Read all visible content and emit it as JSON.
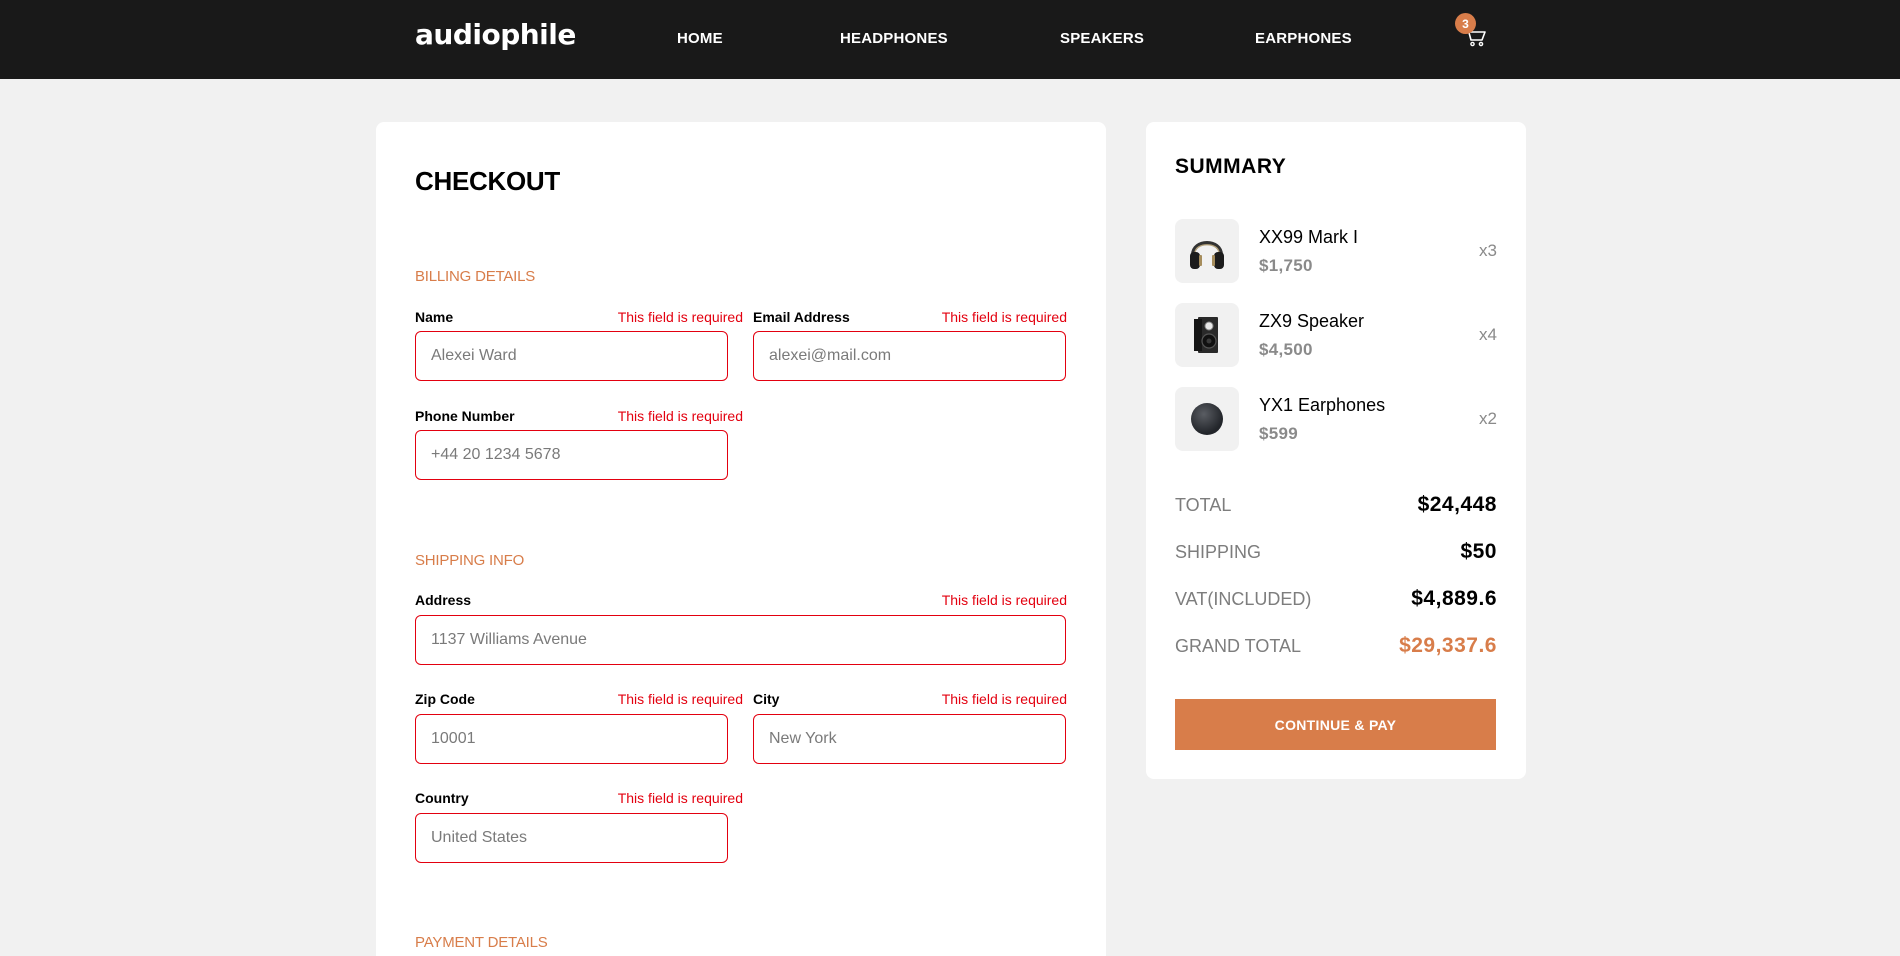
{
  "header": {
    "logo": "audiophile",
    "nav": [
      "HOME",
      "HEADPHONES",
      "SPEAKERS",
      "EARPHONES"
    ],
    "cart_count": "3",
    "cart_icon": "cart-icon"
  },
  "checkout": {
    "title": "CHECKOUT",
    "billing": {
      "title": "BILLING DETAILS",
      "name": {
        "label": "Name",
        "error": "This field is required",
        "placeholder": "Alexei Ward"
      },
      "email": {
        "label": "Email Address",
        "error": "This field is required",
        "placeholder": "alexei@mail.com"
      },
      "phone": {
        "label": "Phone Number",
        "error": "This field is required",
        "placeholder": "+44 20 1234 5678"
      }
    },
    "shipping": {
      "title": "SHIPPING INFO",
      "address": {
        "label": "Address",
        "error": "This field is required",
        "placeholder": "1137 Williams Avenue"
      },
      "zip": {
        "label": "Zip Code",
        "error": "This field is required",
        "placeholder": "10001"
      },
      "city": {
        "label": "City",
        "error": "This field is required",
        "placeholder": "New York"
      },
      "country": {
        "label": "Country",
        "error": "This field is required",
        "placeholder": "United States"
      }
    },
    "payment": {
      "title": "PAYMENT DETAILS"
    }
  },
  "summary": {
    "title": "SUMMARY",
    "items": [
      {
        "name": "XX99 Mark I",
        "price": "$1,750",
        "qty": "x3",
        "icon": "headphones-icon"
      },
      {
        "name": "ZX9 Speaker",
        "price": "$4,500",
        "qty": "x4",
        "icon": "speaker-icon"
      },
      {
        "name": "YX1 Earphones",
        "price": "$599",
        "qty": "x2",
        "icon": "earphones-icon"
      }
    ],
    "totals": [
      {
        "label": "TOTAL",
        "value": "$24,448"
      },
      {
        "label": "SHIPPING",
        "value": "$50"
      },
      {
        "label": "VAT(INCLUDED)",
        "value": "$4,889.6"
      },
      {
        "label": "GRAND TOTAL",
        "value": "$29,337.6"
      }
    ],
    "pay_button": "CONTINUE & PAY"
  },
  "colors": {
    "accent": "#d87d4a",
    "error": "#e3000f",
    "header_bg": "#191919",
    "page_bg": "#f1f1f1"
  }
}
